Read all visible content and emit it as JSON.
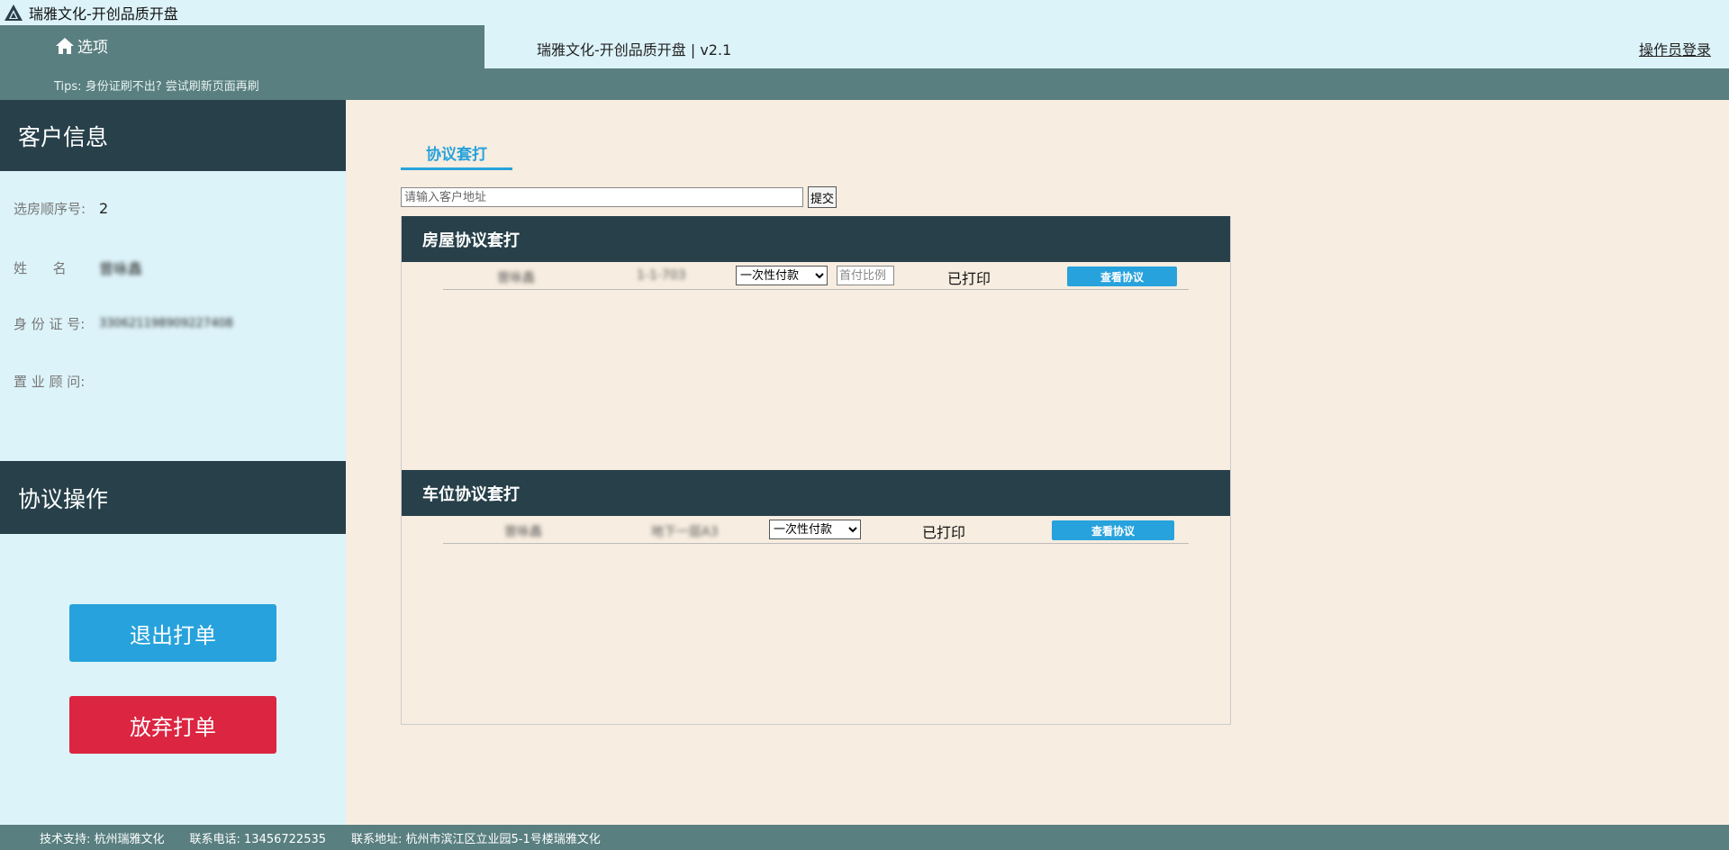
{
  "window": {
    "title": "瑞雅文化-开创品质开盘"
  },
  "header": {
    "home_label": "选项",
    "app_title": "瑞雅文化-开创品质开盘 | v2.1",
    "login_label": "操作员登录",
    "tips": "Tips: 身份证刷不出?  尝试刷新页面再刷"
  },
  "sidebar": {
    "info_title": "客户信息",
    "fields": [
      {
        "label": "选房顺序号:",
        "value": "2"
      },
      {
        "label": "姓      名",
        "value": "曾咏鑫"
      },
      {
        "label": "身 份 证 号:",
        "value": "330621198909227408"
      },
      {
        "label": "置 业 顾 问:",
        "value": ""
      }
    ],
    "ops_title": "协议操作",
    "exit_label": "退出打单",
    "abandon_label": "放弃打单"
  },
  "main": {
    "tab_label": "协议套打",
    "address_placeholder": "请输入客户地址",
    "submit_label": "提交",
    "house_panel": {
      "title": "房屋协议套打",
      "row": {
        "name": "曾咏鑫",
        "unit": "1-1-703",
        "payment": "一次性付款",
        "ratio_placeholder": "首付比例",
        "status": "已打印",
        "view_label": "查看协议"
      }
    },
    "parking_panel": {
      "title": "车位协议套打",
      "row": {
        "name": "曾咏鑫",
        "unit": "地下一层A3",
        "payment": "一次性付款",
        "status": "已打印",
        "view_label": "查看协议"
      }
    }
  },
  "footer": {
    "support": "技术支持:  杭州瑞雅文化",
    "phone": "联系电话:  13456722535",
    "address": "联系地址:  杭州市滨江区立业园5-1号楼瑞雅文化"
  }
}
